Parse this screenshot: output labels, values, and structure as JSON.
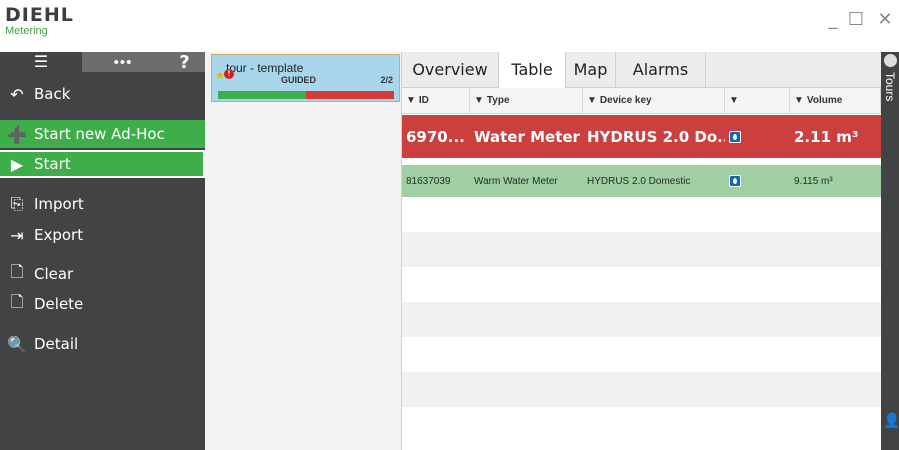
{
  "brand": {
    "name": "DIEHL",
    "sub": "Metering"
  },
  "window_controls": {
    "minimize": "_",
    "maximize": "☐",
    "close": "✕"
  },
  "sidebar": {
    "top": {
      "menu": "☰",
      "more": "•••",
      "help": "?"
    },
    "items": [
      {
        "label": "Back",
        "icon": "back-arrow-icon",
        "glyph": "↶"
      },
      {
        "label": "Start new Ad-Hoc",
        "icon": "add-circle-icon",
        "glyph": "➕"
      },
      {
        "label": "Start",
        "icon": "play-icon",
        "glyph": "▶"
      },
      {
        "label": "Import",
        "icon": "import-icon",
        "glyph": "⎘"
      },
      {
        "label": "Export",
        "icon": "export-icon",
        "glyph": "⇥"
      },
      {
        "label": "Clear",
        "icon": "clear-doc-icon",
        "glyph": "🗋"
      },
      {
        "label": "Delete",
        "icon": "delete-doc-icon",
        "glyph": "🗋"
      },
      {
        "label": "Detail",
        "icon": "search-icon",
        "glyph": "🔍"
      }
    ]
  },
  "tour": {
    "name": "tour - template",
    "mode": "GUIDED",
    "count": "2/2",
    "progress": 0.5
  },
  "tabs": [
    "Overview",
    "Table",
    "Map",
    "Alarms"
  ],
  "active_tab": "Table",
  "table": {
    "columns": [
      "ID",
      "Type",
      "Device key",
      "",
      "Volume"
    ],
    "rows": [
      {
        "id": "6970...",
        "type": "Water Meter",
        "device_key": "HYDRUS 2.0 Do...",
        "volume": "2.11 m³",
        "status": "alarm"
      },
      {
        "id": "81637039",
        "type": "Warm Water Meter",
        "device_key": "HYDRUS 2.0 Domestic",
        "volume": "9.115 m³",
        "status": "ok"
      }
    ]
  },
  "right_rail": {
    "label": "Tours"
  },
  "colors": {
    "sidebar": "#414345",
    "green": "#3dae4a",
    "alarm_row": "#cb3f3f",
    "ok_row": "#9fcfa3",
    "tour_card": "#a9d6ea"
  }
}
